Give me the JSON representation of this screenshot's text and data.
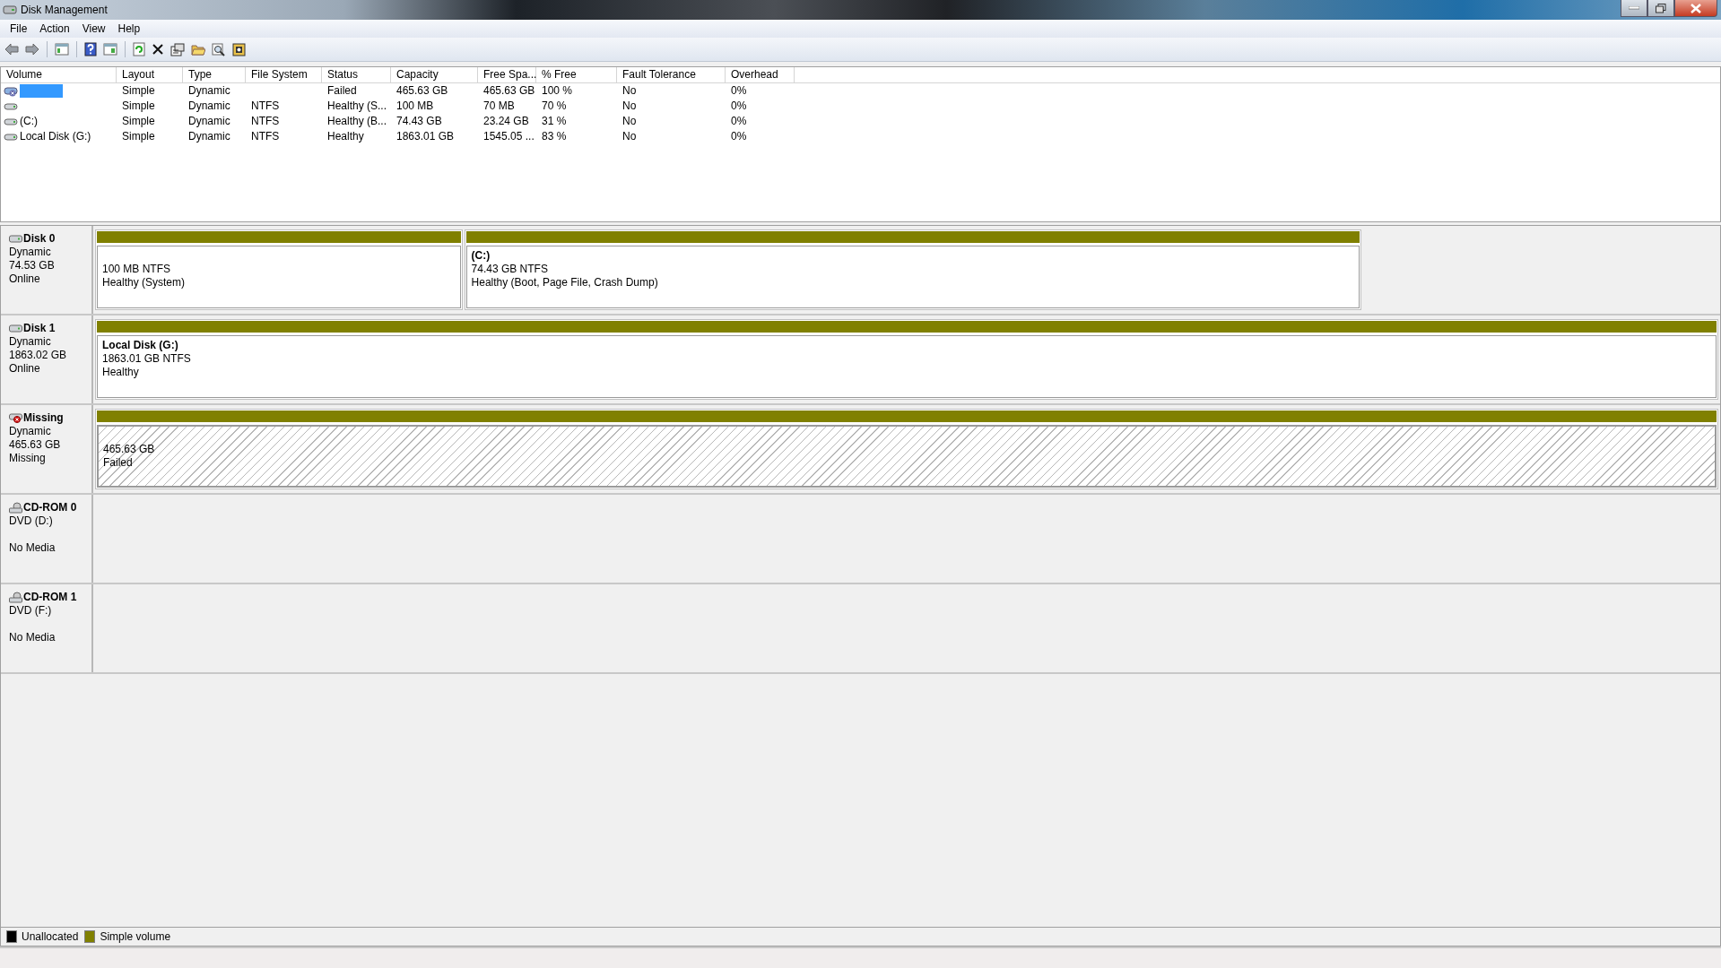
{
  "window": {
    "title": "Disk Management"
  },
  "menu": [
    {
      "label": "File"
    },
    {
      "label": "Action"
    },
    {
      "label": "View"
    },
    {
      "label": "Help"
    }
  ],
  "table": {
    "columns": [
      "Volume",
      "Layout",
      "Type",
      "File System",
      "Status",
      "Capacity",
      "Free Spa...",
      "% Free",
      "Fault Tolerance",
      "Overhead"
    ],
    "rows": [
      {
        "selected": true,
        "kind": "failed",
        "layout": "Simple",
        "type": "Dynamic",
        "status": "Failed",
        "capacity": "465.63 GB",
        "free_space": "465.63 GB",
        "percent_free": "100 %",
        "fault_tolerance": "No",
        "overhead": "0%"
      },
      {
        "selected": false,
        "kind": "disk",
        "layout": "Simple",
        "type": "Dynamic",
        "file_system": "NTFS",
        "status": "Healthy (S...",
        "capacity": "100 MB",
        "free_space": "70 MB",
        "percent_free": "70 %",
        "fault_tolerance": "No",
        "overhead": "0%"
      },
      {
        "selected": false,
        "kind": "disk",
        "volume": "(C:)",
        "layout": "Simple",
        "type": "Dynamic",
        "file_system": "NTFS",
        "status": "Healthy (B...",
        "capacity": "74.43 GB",
        "free_space": "23.24 GB",
        "percent_free": "31 %",
        "fault_tolerance": "No",
        "overhead": "0%"
      },
      {
        "selected": false,
        "kind": "disk",
        "volume": "Local Disk (G:)",
        "layout": "Simple",
        "type": "Dynamic",
        "file_system": "NTFS",
        "status": "Healthy",
        "capacity": "1863.01 GB",
        "free_space": "1545.05 ...",
        "percent_free": "83 %",
        "fault_tolerance": "No",
        "overhead": "0%"
      }
    ]
  },
  "disks": [
    {
      "kind": "disk",
      "name": "Disk 0",
      "type": "Dynamic",
      "size": "74.53 GB",
      "status": "Online",
      "partitions": [
        {
          "kind": "simple",
          "size": "100 MB NTFS",
          "status": "Healthy (System)"
        },
        {
          "kind": "simple",
          "name": "(C:)",
          "size": "74.43 GB NTFS",
          "status": "Healthy (Boot, Page File, Crash Dump)"
        }
      ]
    },
    {
      "kind": "disk",
      "name": "Disk 1",
      "type": "Dynamic",
      "size": "1863.02 GB",
      "status": "Online",
      "partitions": [
        {
          "kind": "simple",
          "name": "Local Disk  (G:)",
          "size": "1863.01 GB NTFS",
          "status": "Healthy"
        }
      ]
    },
    {
      "kind": "missing",
      "name": "Missing",
      "type": "Dynamic",
      "size": "465.63 GB",
      "status": "Missing",
      "partitions": [
        {
          "kind": "failed",
          "size": "465.63 GB",
          "status": "Failed"
        }
      ]
    },
    {
      "kind": "cdrom",
      "name": "CD-ROM 0",
      "type": "DVD (D:)",
      "status": "No Media"
    },
    {
      "kind": "cdrom",
      "name": "CD-ROM 1",
      "type": "DVD (F:)",
      "status": "No Media"
    }
  ],
  "legend": [
    {
      "label": "Unallocated",
      "color": "#000000"
    },
    {
      "label": "Simple volume",
      "color": "#808000"
    }
  ]
}
